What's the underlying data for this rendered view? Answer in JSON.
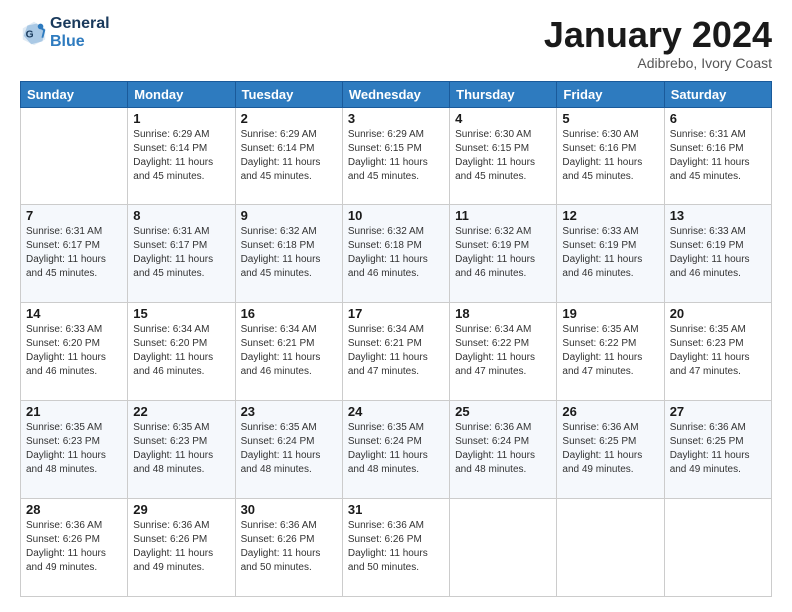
{
  "header": {
    "logo_line1": "General",
    "logo_line2": "Blue",
    "month_title": "January 2024",
    "location": "Adibrebo, Ivory Coast"
  },
  "weekdays": [
    "Sunday",
    "Monday",
    "Tuesday",
    "Wednesday",
    "Thursday",
    "Friday",
    "Saturday"
  ],
  "weeks": [
    [
      {
        "day": "",
        "sunrise": "",
        "sunset": "",
        "daylight": ""
      },
      {
        "day": "1",
        "sunrise": "Sunrise: 6:29 AM",
        "sunset": "Sunset: 6:14 PM",
        "daylight": "Daylight: 11 hours and 45 minutes."
      },
      {
        "day": "2",
        "sunrise": "Sunrise: 6:29 AM",
        "sunset": "Sunset: 6:14 PM",
        "daylight": "Daylight: 11 hours and 45 minutes."
      },
      {
        "day": "3",
        "sunrise": "Sunrise: 6:29 AM",
        "sunset": "Sunset: 6:15 PM",
        "daylight": "Daylight: 11 hours and 45 minutes."
      },
      {
        "day": "4",
        "sunrise": "Sunrise: 6:30 AM",
        "sunset": "Sunset: 6:15 PM",
        "daylight": "Daylight: 11 hours and 45 minutes."
      },
      {
        "day": "5",
        "sunrise": "Sunrise: 6:30 AM",
        "sunset": "Sunset: 6:16 PM",
        "daylight": "Daylight: 11 hours and 45 minutes."
      },
      {
        "day": "6",
        "sunrise": "Sunrise: 6:31 AM",
        "sunset": "Sunset: 6:16 PM",
        "daylight": "Daylight: 11 hours and 45 minutes."
      }
    ],
    [
      {
        "day": "7",
        "sunrise": "Sunrise: 6:31 AM",
        "sunset": "Sunset: 6:17 PM",
        "daylight": "Daylight: 11 hours and 45 minutes."
      },
      {
        "day": "8",
        "sunrise": "Sunrise: 6:31 AM",
        "sunset": "Sunset: 6:17 PM",
        "daylight": "Daylight: 11 hours and 45 minutes."
      },
      {
        "day": "9",
        "sunrise": "Sunrise: 6:32 AM",
        "sunset": "Sunset: 6:18 PM",
        "daylight": "Daylight: 11 hours and 45 minutes."
      },
      {
        "day": "10",
        "sunrise": "Sunrise: 6:32 AM",
        "sunset": "Sunset: 6:18 PM",
        "daylight": "Daylight: 11 hours and 46 minutes."
      },
      {
        "day": "11",
        "sunrise": "Sunrise: 6:32 AM",
        "sunset": "Sunset: 6:19 PM",
        "daylight": "Daylight: 11 hours and 46 minutes."
      },
      {
        "day": "12",
        "sunrise": "Sunrise: 6:33 AM",
        "sunset": "Sunset: 6:19 PM",
        "daylight": "Daylight: 11 hours and 46 minutes."
      },
      {
        "day": "13",
        "sunrise": "Sunrise: 6:33 AM",
        "sunset": "Sunset: 6:19 PM",
        "daylight": "Daylight: 11 hours and 46 minutes."
      }
    ],
    [
      {
        "day": "14",
        "sunrise": "Sunrise: 6:33 AM",
        "sunset": "Sunset: 6:20 PM",
        "daylight": "Daylight: 11 hours and 46 minutes."
      },
      {
        "day": "15",
        "sunrise": "Sunrise: 6:34 AM",
        "sunset": "Sunset: 6:20 PM",
        "daylight": "Daylight: 11 hours and 46 minutes."
      },
      {
        "day": "16",
        "sunrise": "Sunrise: 6:34 AM",
        "sunset": "Sunset: 6:21 PM",
        "daylight": "Daylight: 11 hours and 46 minutes."
      },
      {
        "day": "17",
        "sunrise": "Sunrise: 6:34 AM",
        "sunset": "Sunset: 6:21 PM",
        "daylight": "Daylight: 11 hours and 47 minutes."
      },
      {
        "day": "18",
        "sunrise": "Sunrise: 6:34 AM",
        "sunset": "Sunset: 6:22 PM",
        "daylight": "Daylight: 11 hours and 47 minutes."
      },
      {
        "day": "19",
        "sunrise": "Sunrise: 6:35 AM",
        "sunset": "Sunset: 6:22 PM",
        "daylight": "Daylight: 11 hours and 47 minutes."
      },
      {
        "day": "20",
        "sunrise": "Sunrise: 6:35 AM",
        "sunset": "Sunset: 6:23 PM",
        "daylight": "Daylight: 11 hours and 47 minutes."
      }
    ],
    [
      {
        "day": "21",
        "sunrise": "Sunrise: 6:35 AM",
        "sunset": "Sunset: 6:23 PM",
        "daylight": "Daylight: 11 hours and 48 minutes."
      },
      {
        "day": "22",
        "sunrise": "Sunrise: 6:35 AM",
        "sunset": "Sunset: 6:23 PM",
        "daylight": "Daylight: 11 hours and 48 minutes."
      },
      {
        "day": "23",
        "sunrise": "Sunrise: 6:35 AM",
        "sunset": "Sunset: 6:24 PM",
        "daylight": "Daylight: 11 hours and 48 minutes."
      },
      {
        "day": "24",
        "sunrise": "Sunrise: 6:35 AM",
        "sunset": "Sunset: 6:24 PM",
        "daylight": "Daylight: 11 hours and 48 minutes."
      },
      {
        "day": "25",
        "sunrise": "Sunrise: 6:36 AM",
        "sunset": "Sunset: 6:24 PM",
        "daylight": "Daylight: 11 hours and 48 minutes."
      },
      {
        "day": "26",
        "sunrise": "Sunrise: 6:36 AM",
        "sunset": "Sunset: 6:25 PM",
        "daylight": "Daylight: 11 hours and 49 minutes."
      },
      {
        "day": "27",
        "sunrise": "Sunrise: 6:36 AM",
        "sunset": "Sunset: 6:25 PM",
        "daylight": "Daylight: 11 hours and 49 minutes."
      }
    ],
    [
      {
        "day": "28",
        "sunrise": "Sunrise: 6:36 AM",
        "sunset": "Sunset: 6:26 PM",
        "daylight": "Daylight: 11 hours and 49 minutes."
      },
      {
        "day": "29",
        "sunrise": "Sunrise: 6:36 AM",
        "sunset": "Sunset: 6:26 PM",
        "daylight": "Daylight: 11 hours and 49 minutes."
      },
      {
        "day": "30",
        "sunrise": "Sunrise: 6:36 AM",
        "sunset": "Sunset: 6:26 PM",
        "daylight": "Daylight: 11 hours and 50 minutes."
      },
      {
        "day": "31",
        "sunrise": "Sunrise: 6:36 AM",
        "sunset": "Sunset: 6:26 PM",
        "daylight": "Daylight: 11 hours and 50 minutes."
      },
      {
        "day": "",
        "sunrise": "",
        "sunset": "",
        "daylight": ""
      },
      {
        "day": "",
        "sunrise": "",
        "sunset": "",
        "daylight": ""
      },
      {
        "day": "",
        "sunrise": "",
        "sunset": "",
        "daylight": ""
      }
    ]
  ]
}
